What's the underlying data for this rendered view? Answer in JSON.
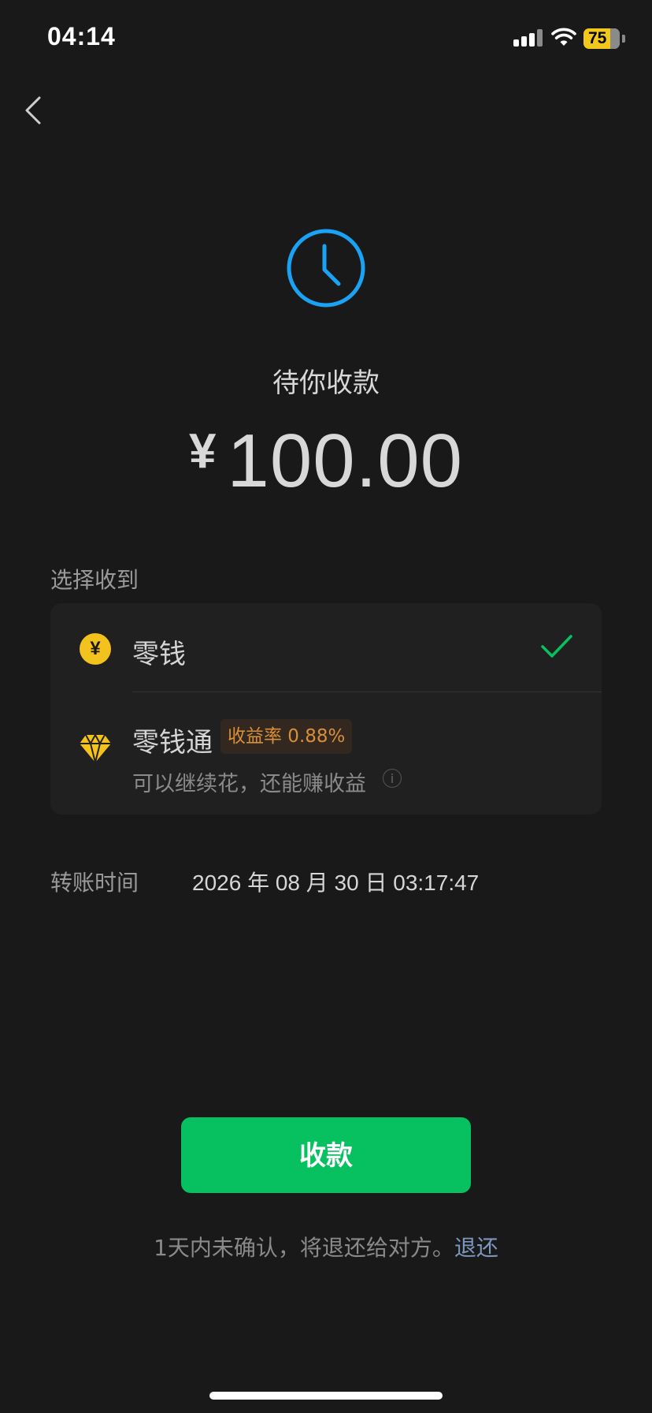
{
  "status_bar": {
    "time": "04:14",
    "battery_level": "75",
    "icons": [
      "signal-icon",
      "wifi-icon",
      "battery-icon"
    ]
  },
  "nav": {
    "back_icon": "chevron-left-icon"
  },
  "status_icon": "clock-icon",
  "title": "待你收款",
  "amount": {
    "currency": "¥",
    "value": "100.00"
  },
  "receive_to": {
    "label": "选择收到",
    "options": [
      {
        "icon": "yuan-coin-icon",
        "icon_glyph": "¥",
        "label": "零钱",
        "selected": true
      },
      {
        "icon": "diamond-icon",
        "label": "零钱通",
        "badge": "收益率 0.88%",
        "subtitle": "可以继续花，还能赚收益",
        "info_glyph": "i",
        "selected": false
      }
    ]
  },
  "transfer_time": {
    "label": "转账时间",
    "value": "2026 年 08 月 30 日 03:17:47"
  },
  "receive_button": "收款",
  "notice": {
    "text": "1天内未确认，将退还给对方。",
    "link": "退还"
  },
  "colors": {
    "background": "#191919",
    "card": "#202020",
    "accent_green": "#07c160",
    "clock_blue": "#1aa3f5",
    "coin_yellow": "#f4c21c",
    "badge_orange": "#d98e3a",
    "link_blue": "#7c96bd"
  }
}
